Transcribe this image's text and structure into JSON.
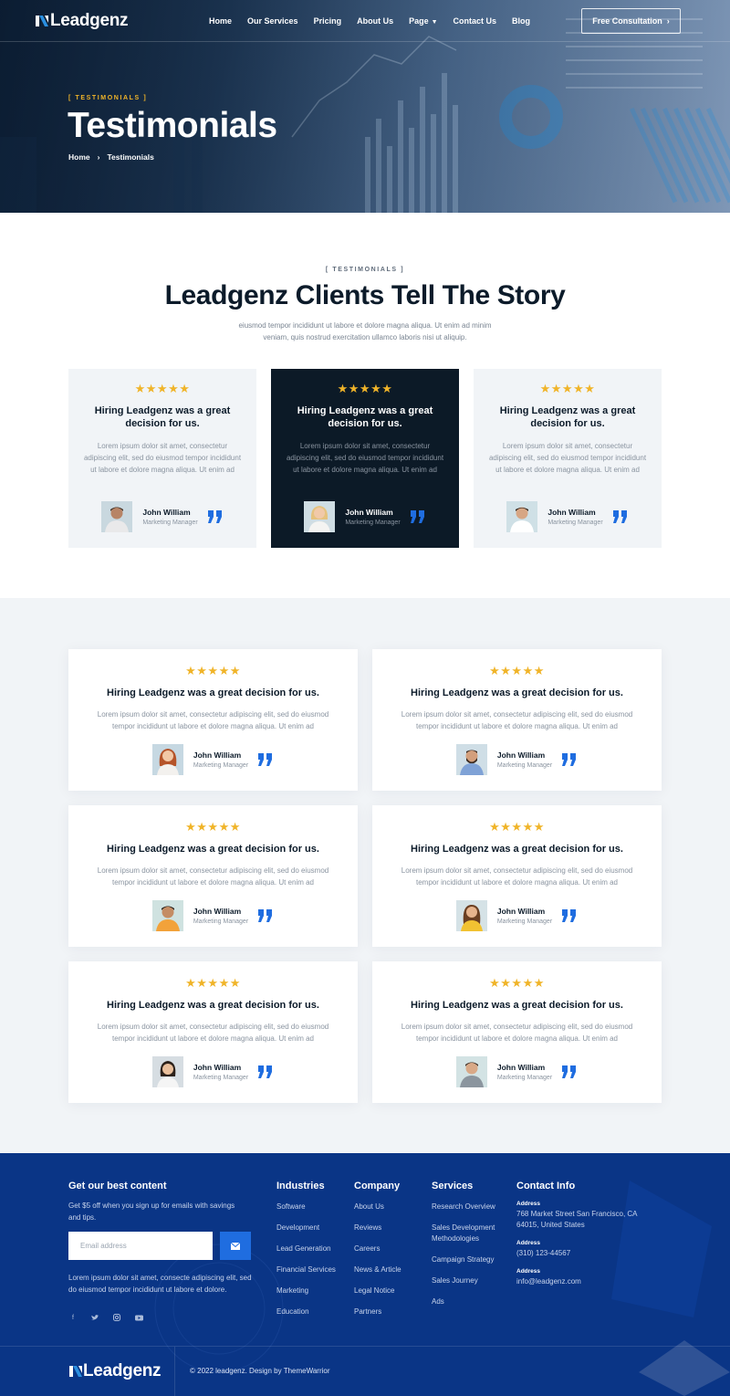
{
  "nav": {
    "logo": "Leadgenz",
    "items": [
      {
        "label": "Home"
      },
      {
        "label": "Our Services"
      },
      {
        "label": "Pricing"
      },
      {
        "label": "About Us"
      },
      {
        "label": "Page"
      },
      {
        "label": "Contact Us"
      },
      {
        "label": "Blog"
      }
    ],
    "cta": "Free Consultation"
  },
  "hero": {
    "tag": "[ TESTIMONIALS ]",
    "title": "Testimonials",
    "breadcrumb": [
      "Home",
      "Testimonials"
    ]
  },
  "section1": {
    "tag": "[ TESTIMONIALS ]",
    "title": "Leadgenz Clients Tell The Story",
    "subtitle": "eiusmod tempor incididunt ut labore et dolore magna aliqua. Ut enim ad minim veniam, quis nostrud exercitation ullamco laboris nisi ut aliquip.",
    "cards": [
      {
        "stars": "★★★★★",
        "title": "Hiring Leadgenz was a great decision for us.",
        "text": "Lorem ipsum dolor sit amet, consectetur adipiscing elit, sed do eiusmod tempor incididunt ut labore et dolore magna aliqua. Ut enim ad",
        "name": "John William",
        "role": "Marketing Manager"
      },
      {
        "stars": "★★★★★",
        "title": "Hiring Leadgenz was a great decision for us.",
        "text": "Lorem ipsum dolor sit amet, consectetur adipiscing elit, sed do eiusmod tempor incididunt ut labore et dolore magna aliqua. Ut enim ad",
        "name": "John William",
        "role": "Marketing Manager"
      },
      {
        "stars": "★★★★★",
        "title": "Hiring Leadgenz was a great decision for us.",
        "text": "Lorem ipsum dolor sit amet, consectetur adipiscing elit, sed do eiusmod tempor incididunt ut labore et dolore magna aliqua. Ut enim ad",
        "name": "John William",
        "role": "Marketing Manager"
      }
    ]
  },
  "section2": {
    "cards": [
      {
        "stars": "★★★★★",
        "title": "Hiring Leadgenz was a great decision for us.",
        "text": "Lorem ipsum dolor sit amet, consectetur adipiscing elit, sed do eiusmod tempor incididunt ut labore et dolore magna aliqua. Ut enim ad",
        "name": "John William",
        "role": "Marketing Manager"
      },
      {
        "stars": "★★★★★",
        "title": "Hiring Leadgenz was a great decision for us.",
        "text": "Lorem ipsum dolor sit amet, consectetur adipiscing elit, sed do eiusmod tempor incididunt ut labore et dolore magna aliqua. Ut enim ad",
        "name": "John William",
        "role": "Marketing Manager"
      },
      {
        "stars": "★★★★★",
        "title": "Hiring Leadgenz was a great decision for us.",
        "text": "Lorem ipsum dolor sit amet, consectetur adipiscing elit, sed do eiusmod tempor incididunt ut labore et dolore magna aliqua. Ut enim ad",
        "name": "John William",
        "role": "Marketing Manager"
      },
      {
        "stars": "★★★★★",
        "title": "Hiring Leadgenz was a great decision for us.",
        "text": "Lorem ipsum dolor sit amet, consectetur adipiscing elit, sed do eiusmod tempor incididunt ut labore et dolore magna aliqua. Ut enim ad",
        "name": "John William",
        "role": "Marketing Manager"
      },
      {
        "stars": "★★★★★",
        "title": "Hiring Leadgenz was a great decision for us.",
        "text": "Lorem ipsum dolor sit amet, consectetur adipiscing elit, sed do eiusmod tempor incididunt ut labore et dolore magna aliqua. Ut enim ad",
        "name": "John William",
        "role": "Marketing Manager"
      },
      {
        "stars": "★★★★★",
        "title": "Hiring Leadgenz was a great decision for us.",
        "text": "Lorem ipsum dolor sit amet, consectetur adipiscing elit, sed do eiusmod tempor incididunt ut labore et dolore magna aliqua. Ut enim ad",
        "name": "John William",
        "role": "Marketing Manager"
      }
    ]
  },
  "footer": {
    "newsletter": {
      "title": "Get our best content",
      "text": "Get $5 off when you sign up for emails with savings and tips.",
      "placeholder": "Email address"
    },
    "description": "Lorem ipsum dolor sit amet, consecte adipiscing elit, sed do eiusmod tempor incididunt ut labore et dolore.",
    "industries": {
      "title": "Industries",
      "links": [
        "Software",
        "Development",
        "Lead Generation",
        "Financial Services",
        "Marketing",
        "Education"
      ]
    },
    "company": {
      "title": "Company",
      "links": [
        "About Us",
        "Reviews",
        "Careers",
        "News & Article",
        "Legal Notice",
        "Partners"
      ]
    },
    "services": {
      "title": "Services",
      "links": [
        "Research Overview",
        "Sales Development Methodologies",
        "Campaign Strategy",
        "Sales Journey",
        "Ads"
      ]
    },
    "contact": {
      "title": "Contact Info",
      "address_label": "Address",
      "address": "768 Market Street San Francisco, CA 64015, United States",
      "phone_label": "Address",
      "phone": "(310) 123-44567",
      "email_label": "Address",
      "email": "info@leadgenz.com"
    },
    "logo": "Leadgenz",
    "copyright": "© 2022 leadgenz. Design by ThemeWarrior"
  },
  "colors": {
    "accent_blue": "#1f6de0",
    "star_gold": "#f0b429",
    "footer_blue": "#0a3586",
    "dark_card": "#0c1a27"
  }
}
